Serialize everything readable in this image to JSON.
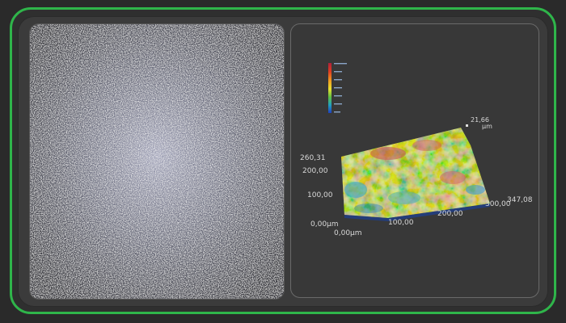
{
  "viewer": {
    "microscope_image": {
      "icon": "microscope-surface-image"
    },
    "surface_plot": {
      "z_top_label": "21,66",
      "z_unit_label": "µm",
      "y_max_label": "260,31",
      "y_ticks": [
        "200,00",
        "100,00"
      ],
      "y_origin_label": "0,00µm",
      "x_origin_label": "0,00µm",
      "x_ticks": [
        "100,00",
        "200,00",
        "300,00"
      ],
      "x_max_label": "347,08"
    },
    "colors": {
      "accent_border": "#2fb54a",
      "panel_bg": "#383838",
      "scale": [
        "#b0203a",
        "#e04020",
        "#f0a020",
        "#e8e030",
        "#60c040",
        "#20a0c0",
        "#2040c0"
      ]
    }
  }
}
